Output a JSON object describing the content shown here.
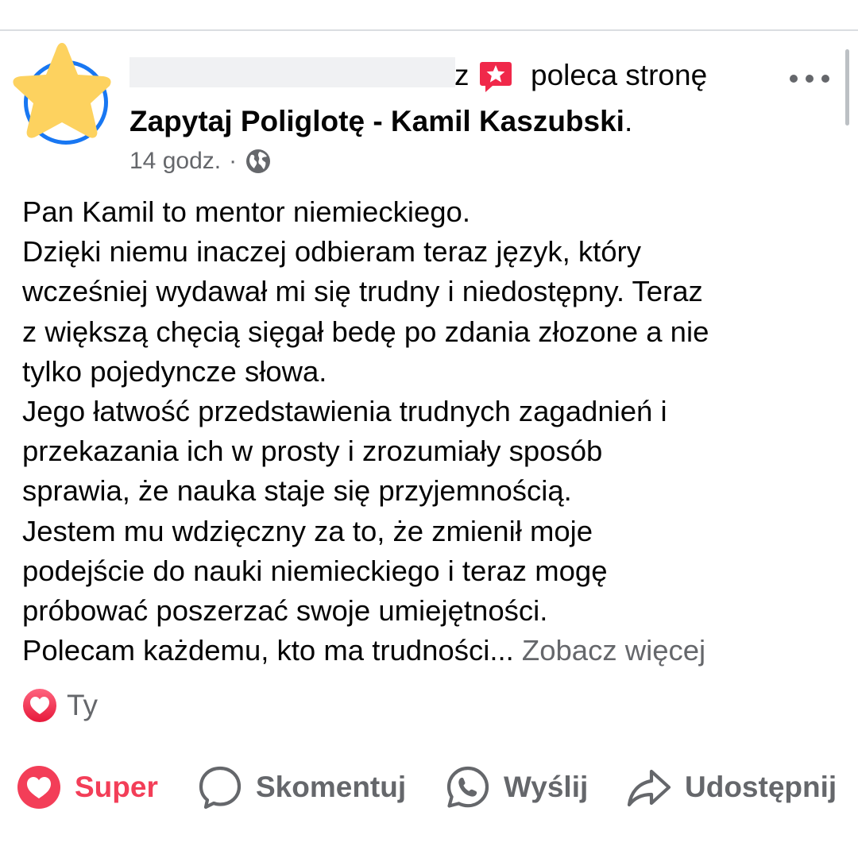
{
  "post": {
    "author_suffix": "z",
    "recommends_text": "poleca stronę",
    "page_name": "Zapytaj Poliglotę - Kamil Kaszubski",
    "page_name_end": ".",
    "timestamp": "14 godz.",
    "separator": "·",
    "privacy_icon": "globe-icon",
    "body_lines": [
      "Pan Kamil to mentor niemieckiego.",
      "Dzięki niemu inaczej odbieram teraz język, który",
      "wcześniej wydawał mi się trudny i niedostępny. Teraz",
      "z większą chęcią sięgał bedę po zdania złozone a nie",
      "tylko pojedyncze słowa.",
      "Jego łatwość przedstawienia trudnych zagadnień i",
      "przekazania ich w prosty i zrozumiały sposób",
      "sprawia, że nauka staje się przyjemnością.",
      "Jestem mu wdzięczny za to, że zmienił moje",
      "podejście do nauki niemieckiego i teraz mogę",
      "próbować poszerzać swoje umiejętności."
    ],
    "last_line": "Polecam każdemu, kto ma trudności...",
    "see_more": "Zobacz więcej"
  },
  "reactions": {
    "label": "Ty",
    "icon": "love-reaction-icon"
  },
  "actions": {
    "super": "Super",
    "comment": "Skomentuj",
    "send": "Wyślij",
    "share": "Udostępnij"
  },
  "colors": {
    "accent_blue": "#1877f2",
    "love_red": "#f33e58",
    "secondary_text": "#65676b",
    "star_yellow": "#fdd25f",
    "recommend_red": "#f0284a"
  }
}
